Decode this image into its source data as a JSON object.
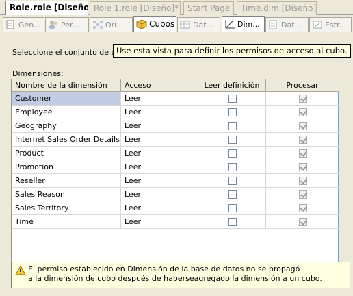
{
  "doc_tabs": [
    {
      "label": "Role.role [Diseño]*",
      "active": true
    },
    {
      "label": "Role 1.role [Diseño]*",
      "active": false
    },
    {
      "label": "Start Page",
      "active": false
    },
    {
      "label": "Time.dim [Diseño]",
      "active": false
    }
  ],
  "tool_tabs": [
    {
      "label": "Gen...",
      "icon": "general-icon"
    },
    {
      "label": "Per...",
      "icon": "members-icon"
    },
    {
      "label": "Orí...",
      "icon": "data-sources-icon"
    },
    {
      "label": "Cubos",
      "icon": "cube-icon",
      "active": true
    },
    {
      "label": "Dat...",
      "icon": "cell-data-icon"
    },
    {
      "label": "Dim...",
      "icon": "dimensions-icon"
    },
    {
      "label": "Dat...",
      "icon": "dimension-data-icon"
    },
    {
      "label": "Estr...",
      "icon": "mining-structures-icon"
    }
  ],
  "instruction": "Seleccione el conjunto de dimensiones:",
  "tooltip": "Use esta vista para definir los permisos de acceso al cubo.",
  "dimensions_label": "Dimensiones:",
  "columns": [
    "Nombre de la dimensión",
    "Acceso",
    "Leer definición",
    "Procesar"
  ],
  "rows": [
    {
      "name": "Customer",
      "access": "Leer",
      "read_definition": false,
      "process": true
    },
    {
      "name": "Employee",
      "access": "Leer",
      "read_definition": false,
      "process": true
    },
    {
      "name": "Geography",
      "access": "Leer",
      "read_definition": false,
      "process": true
    },
    {
      "name": "Internet Sales Order Details",
      "access": "Leer",
      "read_definition": false,
      "process": true
    },
    {
      "name": "Product",
      "access": "Leer",
      "read_definition": false,
      "process": true
    },
    {
      "name": "Promotion",
      "access": "Leer",
      "read_definition": false,
      "process": true
    },
    {
      "name": "Reseller",
      "access": "Leer",
      "read_definition": false,
      "process": true
    },
    {
      "name": "Sales Reason",
      "access": "Leer",
      "read_definition": false,
      "process": true
    },
    {
      "name": "Sales Territory",
      "access": "Leer",
      "read_definition": false,
      "process": true
    },
    {
      "name": "Time",
      "access": "Leer",
      "read_definition": false,
      "process": true
    }
  ],
  "warning": {
    "icon": "warning-icon",
    "line1": "El permiso establecido en Dimensión de la base de datos no se propagó",
    "line2": "a la dimensión de cubo después de haberseagregado la dimensión a un cubo."
  },
  "colors": {
    "selection": "#c2cde3",
    "tooltip_bg": "#ffffe1",
    "chrome": "#ece9d8"
  }
}
